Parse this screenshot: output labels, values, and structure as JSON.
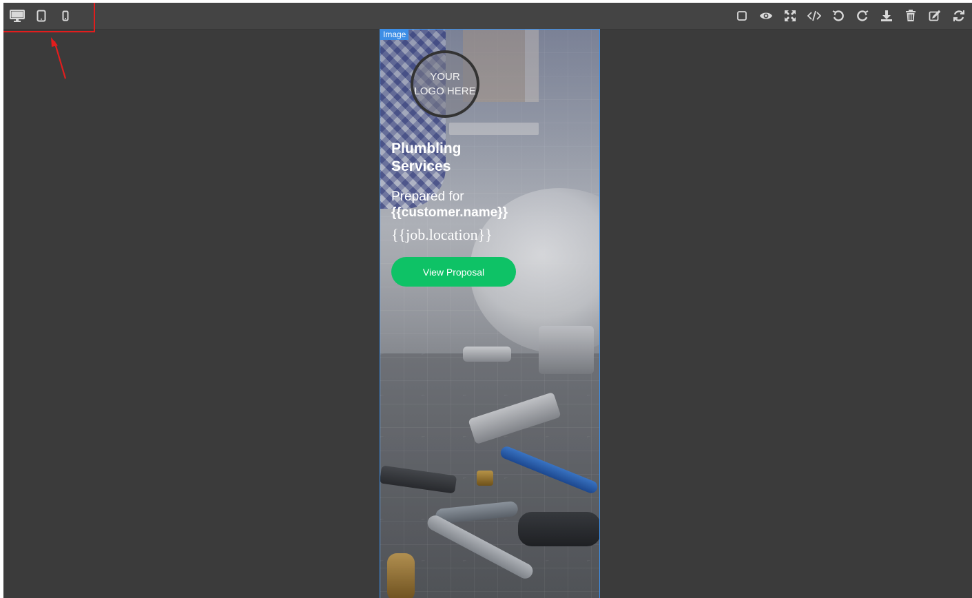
{
  "toolbar": {
    "devices": [
      {
        "name": "desktop",
        "icon": "desktop-icon"
      },
      {
        "name": "tablet",
        "icon": "tablet-icon"
      },
      {
        "name": "mobile",
        "icon": "mobile-icon"
      }
    ],
    "actions": [
      {
        "name": "sw-visibility",
        "icon": "square-outline-icon"
      },
      {
        "name": "preview",
        "icon": "eye-icon"
      },
      {
        "name": "fullscreen",
        "icon": "expand-arrows-icon"
      },
      {
        "name": "export-code",
        "icon": "code-icon"
      },
      {
        "name": "undo",
        "icon": "undo-icon"
      },
      {
        "name": "redo",
        "icon": "redo-icon"
      },
      {
        "name": "import",
        "icon": "download-icon"
      },
      {
        "name": "clear-canvas",
        "icon": "trash-icon"
      },
      {
        "name": "edit",
        "icon": "edit-icon"
      },
      {
        "name": "refresh",
        "icon": "refresh-icon"
      }
    ]
  },
  "canvas": {
    "selected_label": "Image",
    "logo_text": "YOUR LOGO HERE",
    "headline": "Plumbling Services",
    "prepared_for": "Prepared for",
    "customer_placeholder": "{{customer.name}}",
    "location_placeholder": "{{job.location}}",
    "cta_label": "View Proposal"
  },
  "colors": {
    "toolbar_bg": "#444444",
    "workspace_bg": "#3b3b3b",
    "selection_blue": "#3d8ee6",
    "cta_green": "#0ec266",
    "annotation_red": "#e21d1d"
  }
}
